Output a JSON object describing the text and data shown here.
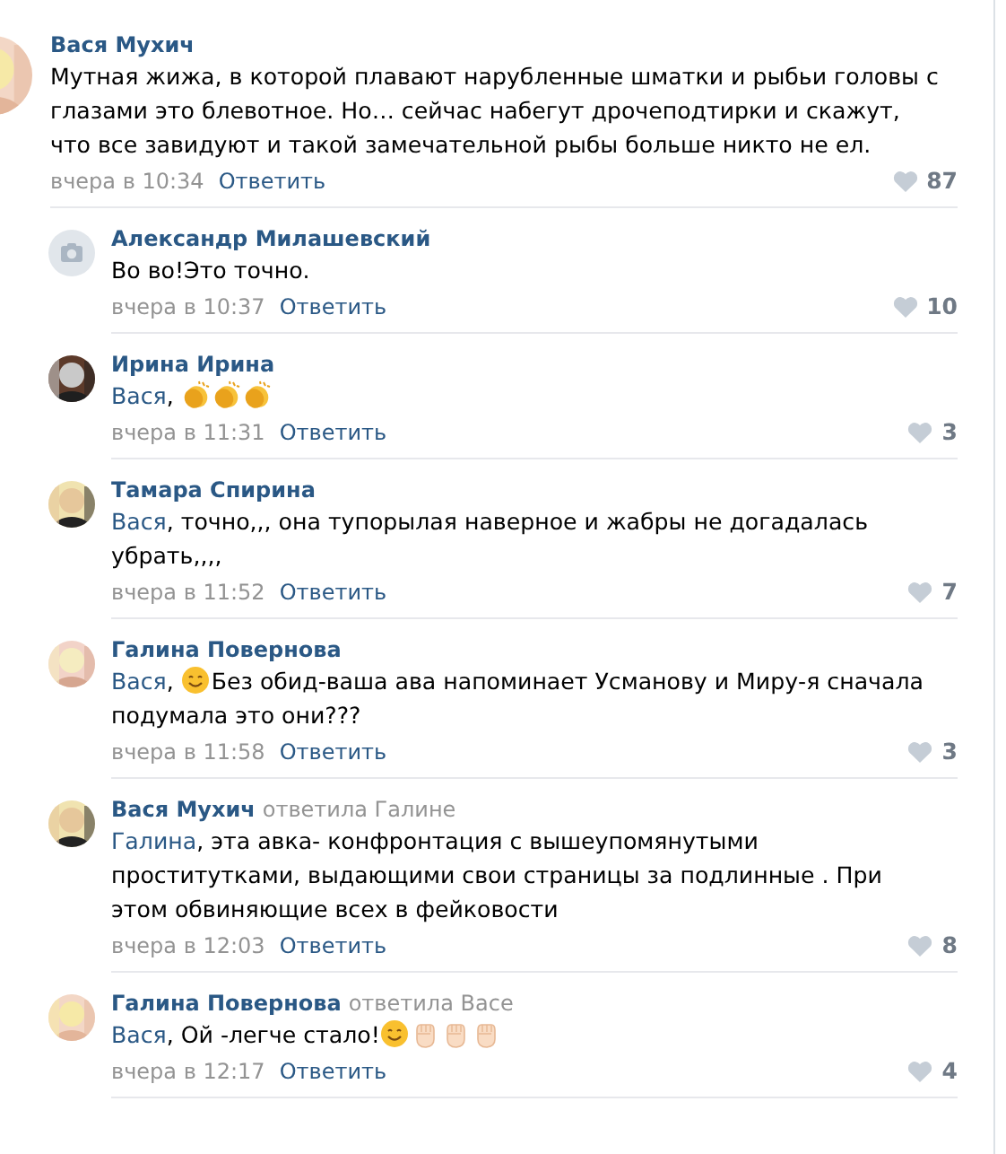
{
  "thread": {
    "author": "Вася Мухич",
    "avatar": {
      "kind": "picture"
    },
    "content": [
      {
        "kind": "text",
        "text": "Мутная жижа, в которой плавают нарубленные шматки и рыбьи головы с глазами это блевотное. Но… сейчас набегут дрочеподтирки и скажут, что все завидуют и такой замечательной рыбы больше никто не ел."
      }
    ],
    "time": "вчера в 10:34",
    "reply_label": "Ответить",
    "likes": "87",
    "children": [
      {
        "author": "Александр Милашевский",
        "avatar": {
          "kind": "placeholder"
        },
        "content": [
          {
            "kind": "text",
            "text": "Во во!Это точно."
          }
        ],
        "time": "вчера в 10:37",
        "reply_label": "Ответить",
        "likes": "10"
      },
      {
        "author": "Ирина Ирина",
        "avatar": {
          "kind": "picture"
        },
        "content": [
          {
            "kind": "mention",
            "text": "Вася"
          },
          {
            "kind": "text",
            "text": ", "
          },
          {
            "kind": "clap"
          },
          {
            "kind": "clap"
          },
          {
            "kind": "clap"
          }
        ],
        "time": "вчера в 11:31",
        "reply_label": "Ответить",
        "likes": "3"
      },
      {
        "author": "Тамара Спирина",
        "avatar": {
          "kind": "picture"
        },
        "content": [
          {
            "kind": "mention",
            "text": "Вася"
          },
          {
            "kind": "text",
            "text": ", точно,,, она тупорылая наверное и жабры не догадалась убрать,,,,"
          }
        ],
        "time": "вчера в 11:52",
        "reply_label": "Ответить",
        "likes": "7"
      },
      {
        "author": "Галина Повернова",
        "avatar": {
          "kind": "picture"
        },
        "content": [
          {
            "kind": "mention",
            "text": "Вася"
          },
          {
            "kind": "text",
            "text": ", "
          },
          {
            "kind": "smile"
          },
          {
            "kind": "text",
            "text": "Без обид-ваша ава напоминает Усманову и Миру-я сначала подумала это они???"
          }
        ],
        "time": "вчера в 11:58",
        "reply_label": "Ответить",
        "likes": "3"
      },
      {
        "author": "Вася Мухич",
        "reply_to": "ответила Галине",
        "avatar": {
          "kind": "picture"
        },
        "content": [
          {
            "kind": "mention",
            "text": "Галина"
          },
          {
            "kind": "text",
            "text": ", эта авка- конфронтация с вышеупомянутыми проститутками, выдающими свои страницы за подлинные . При этом обвиняющие всех в фейковости"
          }
        ],
        "time": "вчера в 12:03",
        "reply_label": "Ответить",
        "likes": "8"
      },
      {
        "author": "Галина Повернова",
        "reply_to": "ответила Васе",
        "avatar": {
          "kind": "picture"
        },
        "content": [
          {
            "kind": "mention",
            "text": "Вася"
          },
          {
            "kind": "text",
            "text": ", Ой -легче стало!"
          },
          {
            "kind": "smile"
          },
          {
            "kind": "fist"
          },
          {
            "kind": "fist"
          },
          {
            "kind": "fist"
          }
        ],
        "time": "вчера в 12:17",
        "reply_label": "Ответить",
        "likes": "4"
      }
    ]
  }
}
